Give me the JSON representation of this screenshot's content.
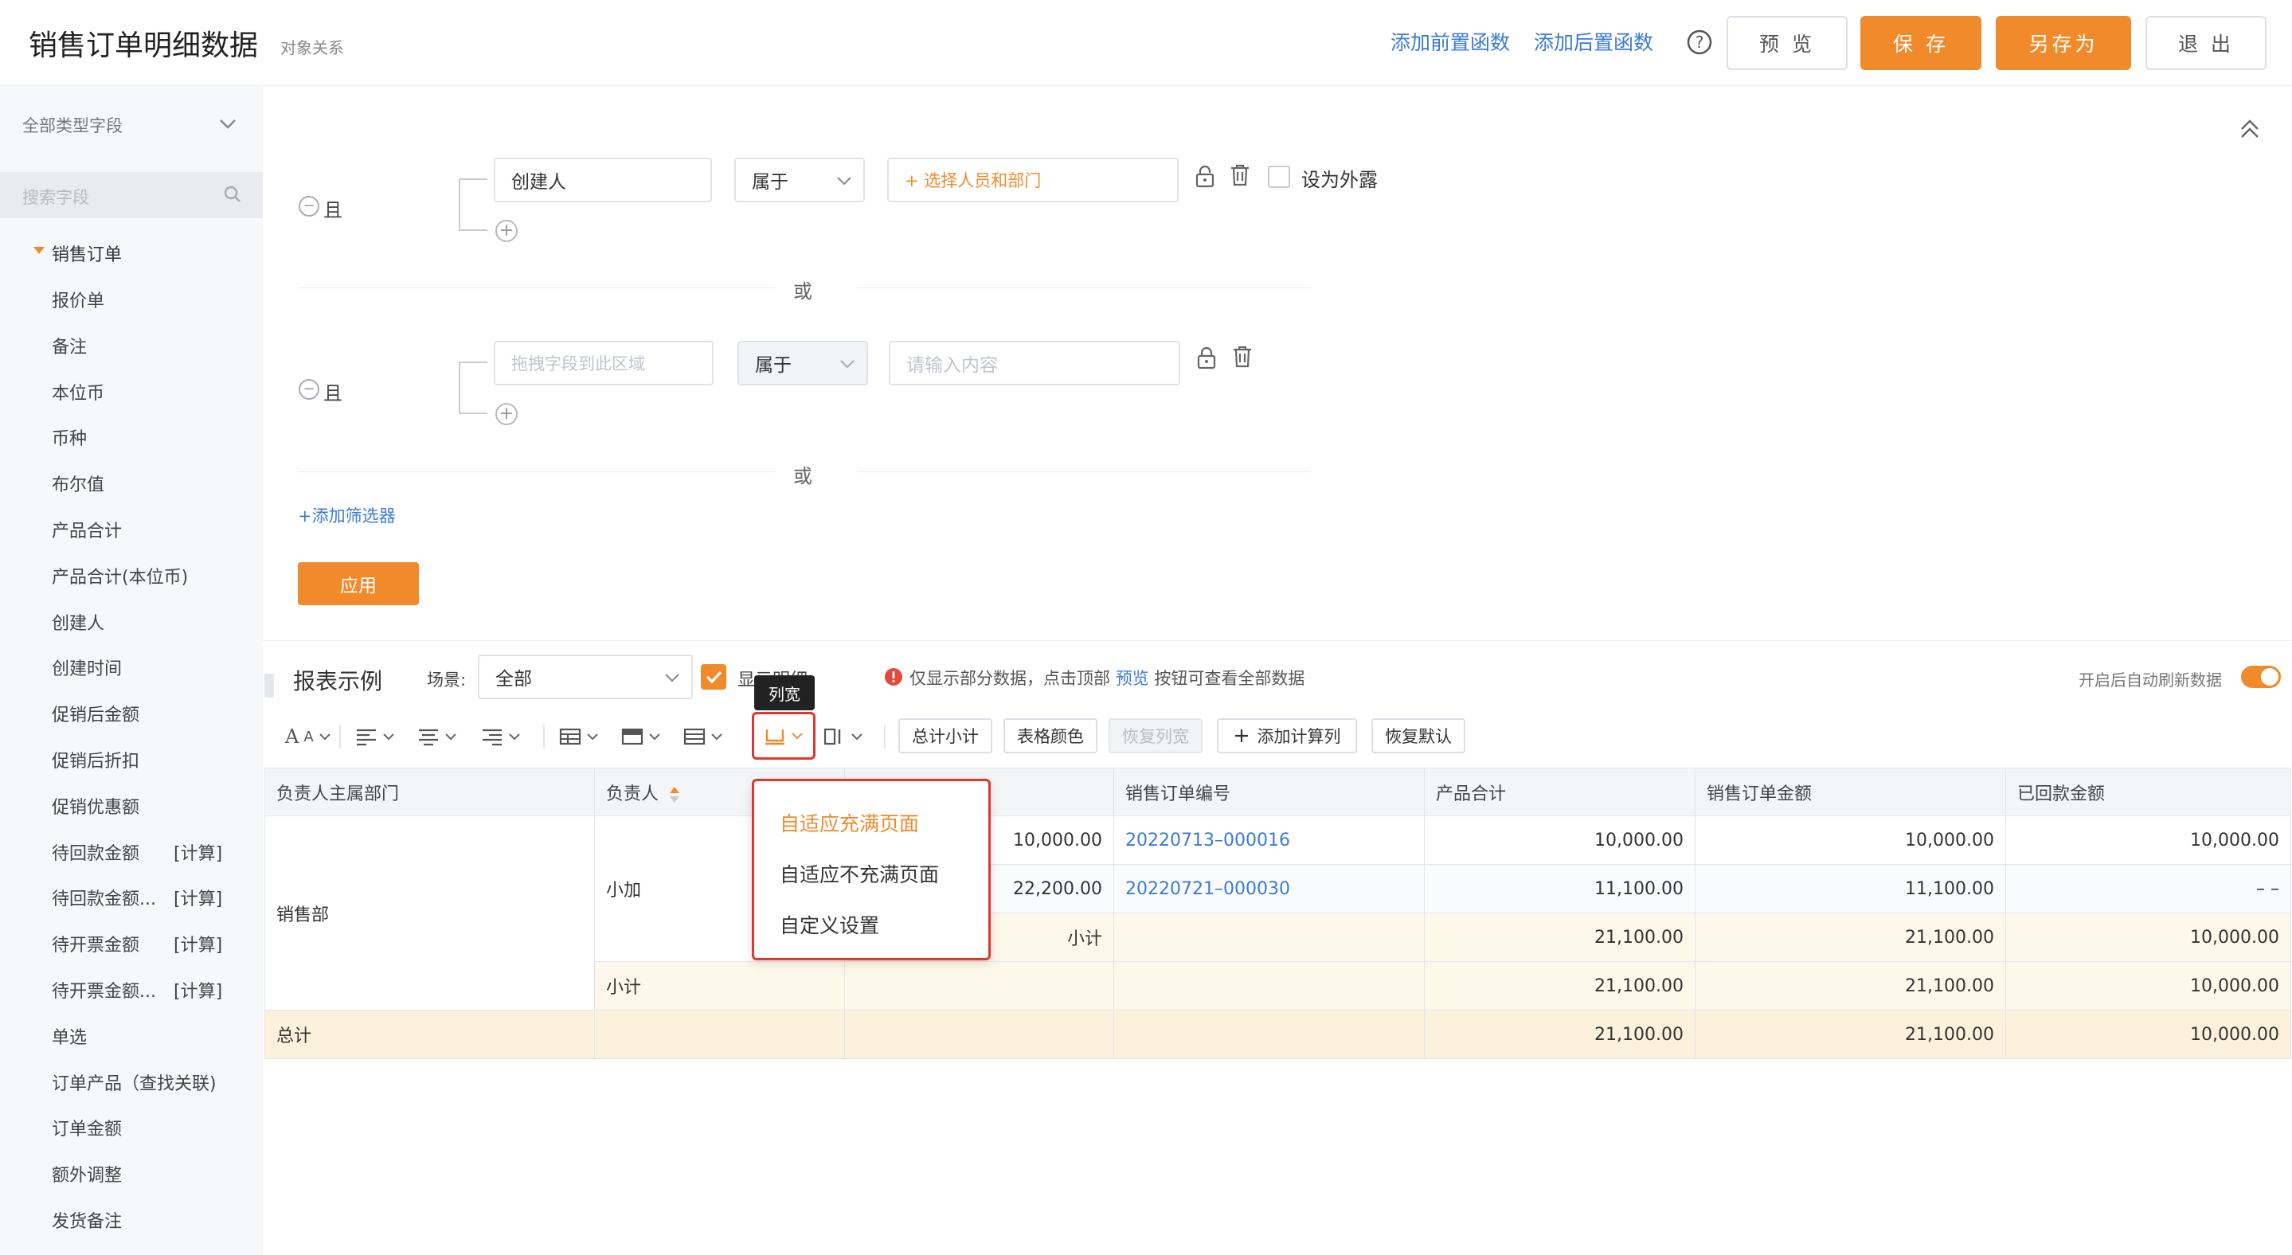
{
  "header": {
    "title": "销售订单明细数据",
    "subtitle": "对象关系",
    "add_pre_function": "添加前置函数",
    "add_post_function": "添加后置函数",
    "preview": "预 览",
    "save": "保 存",
    "save_as": "另存为",
    "exit": "退 出"
  },
  "sidebar": {
    "type_select": "全部类型字段",
    "search_placeholder": "搜索字段",
    "group": "销售订单",
    "items": [
      {
        "label": "报价单",
        "tag": ""
      },
      {
        "label": "备注",
        "tag": ""
      },
      {
        "label": "本位币",
        "tag": ""
      },
      {
        "label": "币种",
        "tag": ""
      },
      {
        "label": "布尔值",
        "tag": ""
      },
      {
        "label": "产品合计",
        "tag": ""
      },
      {
        "label": "产品合计(本位币)",
        "tag": ""
      },
      {
        "label": "创建人",
        "tag": ""
      },
      {
        "label": "创建时间",
        "tag": ""
      },
      {
        "label": "促销后金额",
        "tag": ""
      },
      {
        "label": "促销后折扣",
        "tag": ""
      },
      {
        "label": "促销优惠额",
        "tag": ""
      },
      {
        "label": "待回款金额",
        "tag": "[计算]"
      },
      {
        "label": "待回款金额...",
        "tag": "[计算]"
      },
      {
        "label": "待开票金额",
        "tag": "[计算]"
      },
      {
        "label": "待开票金额...",
        "tag": "[计算]"
      },
      {
        "label": "单选",
        "tag": ""
      },
      {
        "label": "订单产品（查找关联)",
        "tag": ""
      },
      {
        "label": "订单金额",
        "tag": ""
      },
      {
        "label": "额外调整",
        "tag": ""
      },
      {
        "label": "发货备注",
        "tag": ""
      }
    ]
  },
  "filters": {
    "and_label": "且",
    "or_label": "或",
    "row1": {
      "field": "创建人",
      "operator": "属于",
      "value_placeholder": "+ 选择人员和部门",
      "expose_label": "设为外露"
    },
    "row2": {
      "field_placeholder": "拖拽字段到此区域",
      "operator": "属于",
      "value_placeholder": "请输入内容"
    },
    "add_filter": "+添加筛选器",
    "apply": "应用"
  },
  "report": {
    "title": "报表示例",
    "scene_label": "场景:",
    "scene_value": "全部",
    "show_detail": "显示明细",
    "notice": "仅显示部分数据，点击顶部",
    "notice_link": "预览",
    "notice_end": "按钮可查看全部数据",
    "auto_refresh": "开启后自动刷新数据",
    "toolbar": {
      "subtotal": "总计小计",
      "table_color": "表格颜色",
      "restore_width": "恢复列宽",
      "add_calc_col": "添加计算列",
      "restore_default": "恢复默认",
      "tooltip": "列宽"
    },
    "dropdown": [
      "自适应充满页面",
      "自适应不充满页面",
      "自定义设置"
    ],
    "columns": [
      "负责人主属部门",
      "负责人",
      "",
      "销售订单编号",
      "产品合计",
      "销售订单金额",
      "已回款金额"
    ],
    "rows": [
      {
        "c3": "10,000.00",
        "c4": "20220713–000016",
        "c5": "10,000.00",
        "c6": "10,000.00",
        "c7": "10,000.00"
      },
      {
        "c3": "22,200.00",
        "c4": "20220721–000030",
        "c5": "11,100.00",
        "c6": "11,100.00",
        "c7": "– –"
      }
    ],
    "dept": "销售部",
    "owner": "小加",
    "subtotal_label": "小计",
    "subtotal_row": {
      "c5": "21,100.00",
      "c6": "21,100.00",
      "c7": "10,000.00"
    },
    "subtotal2_label": "小计",
    "subtotal2_row": {
      "c5": "21,100.00",
      "c6": "21,100.00",
      "c7": "10,000.00"
    },
    "total_label": "总计",
    "total_row": {
      "c5": "21,100.00",
      "c6": "21,100.00",
      "c7": "10,000.00"
    }
  },
  "colors": {
    "accent": "#f08a2b",
    "link": "#3a7bd5",
    "highlight": "#e0372e"
  }
}
